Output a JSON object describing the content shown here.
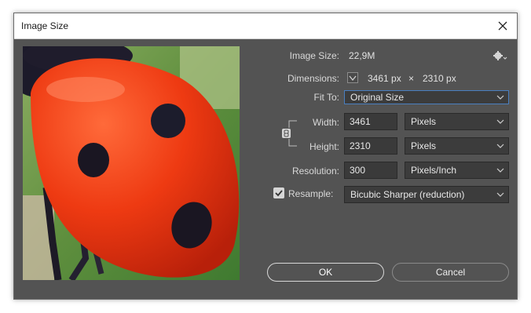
{
  "window": {
    "title": "Image Size"
  },
  "info": {
    "image_size_label": "Image Size:",
    "image_size_value": "22,9M",
    "dimensions_label": "Dimensions:",
    "dim_width": "3461 px",
    "dim_times": "×",
    "dim_height": "2310 px"
  },
  "fit_to": {
    "label": "Fit To:",
    "value": "Original Size"
  },
  "width": {
    "label": "Width:",
    "value": "3461",
    "unit": "Pixels"
  },
  "height": {
    "label": "Height:",
    "value": "2310",
    "unit": "Pixels"
  },
  "resolution": {
    "label": "Resolution:",
    "value": "300",
    "unit": "Pixels/Inch"
  },
  "resample": {
    "label": "Resample:",
    "checked": true,
    "method": "Bicubic Sharper (reduction)"
  },
  "buttons": {
    "ok": "OK",
    "cancel": "Cancel"
  },
  "colors": {
    "dialog_bg": "#535353",
    "field_bg": "#3a3a3a",
    "focus": "#4a7fc0"
  }
}
